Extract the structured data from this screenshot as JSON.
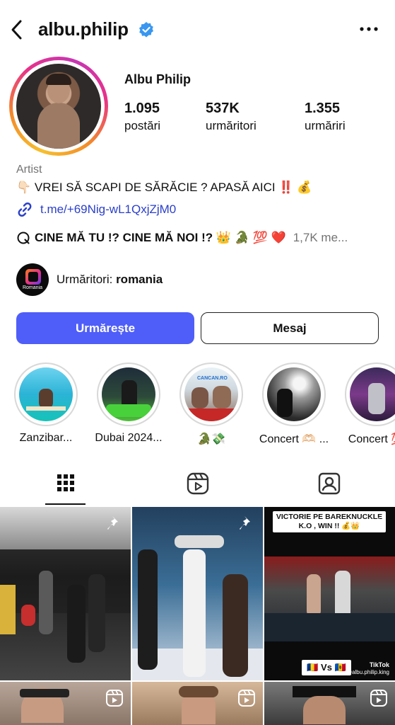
{
  "header": {
    "username": "albu.philip"
  },
  "profile": {
    "display_name": "Albu Philip",
    "stats": [
      {
        "value": "1.095",
        "label": "postări"
      },
      {
        "value": "537K",
        "label": "urmăritori"
      },
      {
        "value": "1.355",
        "label": "urmăriri"
      }
    ],
    "category": "Artist",
    "bio_line": "👇🏻 VREI SĂ SCAPI DE SĂRĂCIE ? APASĂ AICI ‼️ 💰",
    "link": "t.me/+69Nig-wL1QxjZjM0",
    "thread_text": "CINE MĂ TU !? CINE MĂ NOI !? 👑 🐊 💯 ❤️",
    "thread_count": "1,7K me...",
    "followers_prefix": "Urmăritori: ",
    "followers_region": "romania",
    "followers_avatar_text": "Romania"
  },
  "buttons": {
    "follow": "Urmărește",
    "message": "Mesaj"
  },
  "highlights": [
    {
      "label": "Zanzibar..."
    },
    {
      "label": "Dubai 2024..."
    },
    {
      "label": "🐊💸"
    },
    {
      "label": "Concert 🫶🏻 ..."
    },
    {
      "label": "Concert 💯"
    }
  ],
  "highlight_photo_text": "CANCAN.RO",
  "posts": {
    "post3_caption": "VICTORIE PE BAREKNUCKLE K.O , WIN !! 💰👑",
    "post3_vs": "🇷🇴 Vs 🇲🇩",
    "post3_tiktok": "TikTok",
    "post3_tiktok_handle": "@albu.philip.king"
  },
  "colors": {
    "accent": "#4f5ef8",
    "link": "#2b40c9",
    "muted": "#737373"
  }
}
